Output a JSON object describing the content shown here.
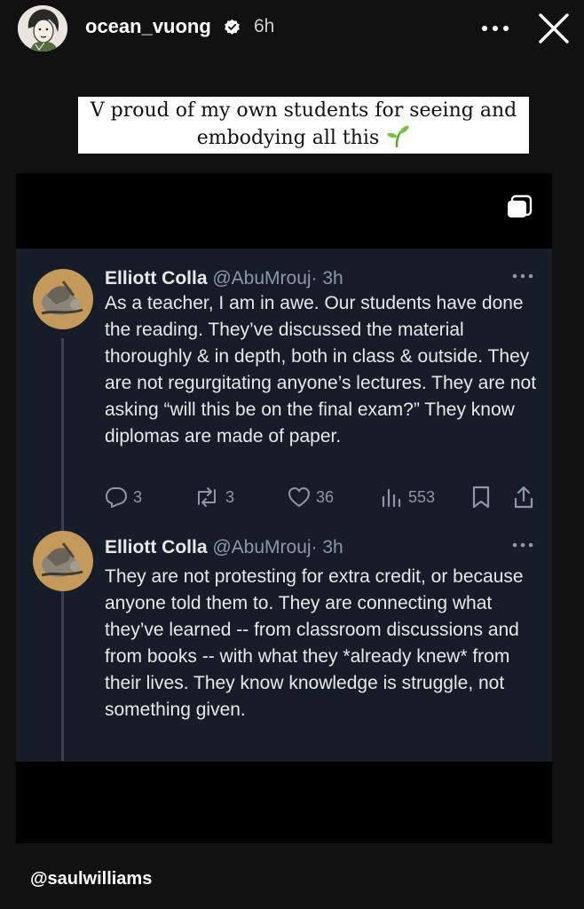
{
  "story": {
    "username": "ocean_vuong",
    "time": "6h",
    "caption_line1": "V proud of my own students for seeing and",
    "caption_line2": "embodying all this",
    "mention": "@saulwilliams"
  },
  "tweets": [
    {
      "name": "Elliott Colla",
      "handle": "@AbuMrouj",
      "time": "· 3h",
      "text": "As a teacher, I am in awe. Our students have done the reading. They’ve discussed the material thoroughly & in depth, both in class & outside. They are not regurgitating anyone’s lectures. They are not asking “will this be on the final exam?” They know diplomas are made of paper.",
      "replies": "3",
      "reposts": "3",
      "likes": "36",
      "views": "553"
    },
    {
      "name": "Elliott Colla",
      "handle": "@AbuMrouj",
      "time": "· 3h",
      "text": "They are not protesting for extra credit, or because anyone told them to. They are connecting what they’ve learned -- from classroom discussions and from books -- with what they *already knew* from their lives. They know knowledge is struggle, not something given."
    }
  ],
  "icons": {
    "verified": "verified-badge-icon",
    "more": "more-options-icon",
    "close": "close-icon",
    "copy": "copy-icon",
    "sprout": "seedling-emoji",
    "reply": "reply-icon",
    "repost": "repost-icon",
    "like": "heart-icon",
    "views": "views-icon",
    "bookmark": "bookmark-icon",
    "share": "share-icon"
  },
  "colors": {
    "tweet_background": "#161c28",
    "story_background": "#111111",
    "muted_text": "#8b98a5",
    "sprout_green": "#7cc242"
  }
}
